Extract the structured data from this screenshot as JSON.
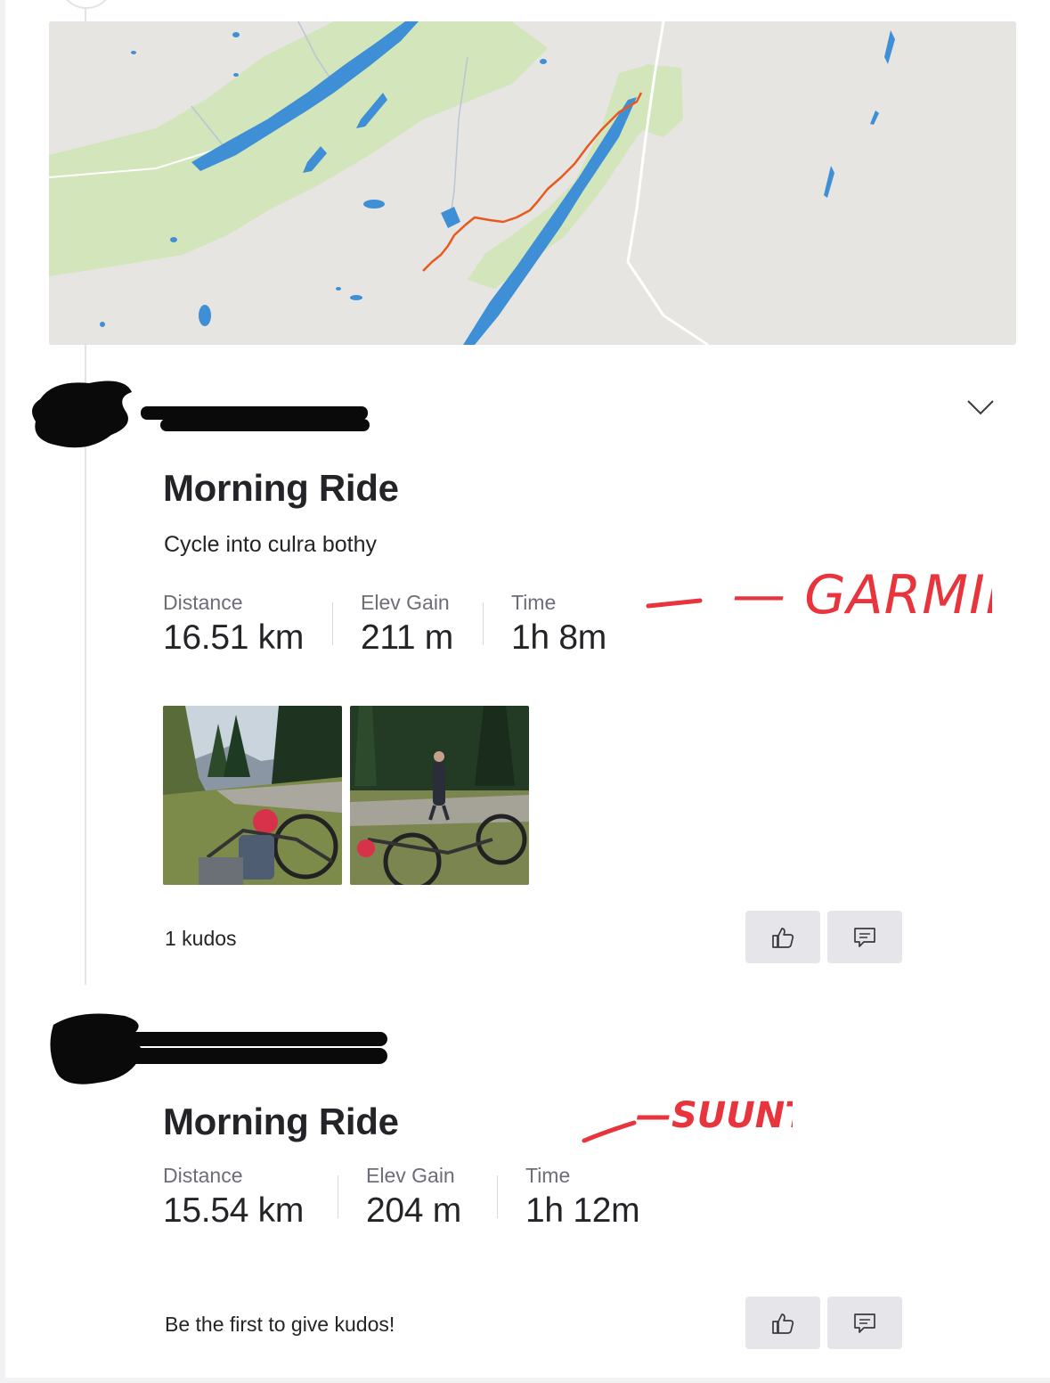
{
  "map": {
    "route_color": "#e7591e",
    "water_color": "#3e8fd6",
    "land_color": "#e7e5e1",
    "park_color": "#cfe3b5"
  },
  "activities": [
    {
      "title": "Morning Ride",
      "description": "Cycle into culra bothy",
      "stats": [
        {
          "label": "Distance",
          "value": "16.51 km"
        },
        {
          "label": "Elev Gain",
          "value": "211 m"
        },
        {
          "label": "Time",
          "value": "1h 8m"
        }
      ],
      "photos": [
        "bike-photo",
        "runner-photo"
      ],
      "kudos_text": "1 kudos",
      "annotation": "— GARMIN."
    },
    {
      "title": "Morning Ride",
      "stats": [
        {
          "label": "Distance",
          "value": "15.54 km"
        },
        {
          "label": "Elev Gain",
          "value": "204 m"
        },
        {
          "label": "Time",
          "value": "1h 12m"
        }
      ],
      "kudos_text": "Be the first to give kudos!",
      "annotation": "—SUUNTO"
    }
  ],
  "icons": {
    "more": "chevron-down-icon",
    "kudos": "thumbs-up-icon",
    "comment": "comment-icon"
  },
  "colors": {
    "annotation": "#e8353d",
    "button_bg": "#e6e6ea",
    "text": "#242428",
    "muted": "#6d6d78"
  }
}
